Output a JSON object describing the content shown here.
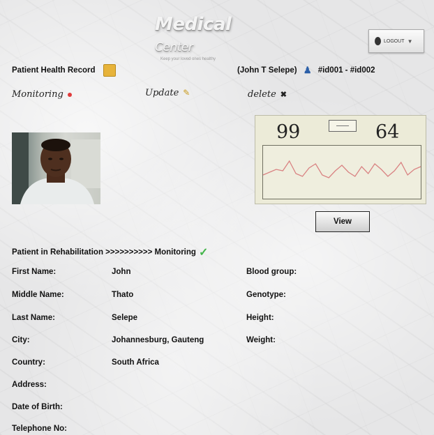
{
  "header": {
    "brand_main": "Medical",
    "brand_sub": "Center",
    "tagline": "Keep your loved ones healthy",
    "logout_label": "LOGOUT"
  },
  "record": {
    "title": "Patient Health Record",
    "patient_tag": "(John T Selepe)",
    "ids": "#id001 - #id002"
  },
  "actions": {
    "monitoring": "Monitoring",
    "update": "Update",
    "delete": "delete"
  },
  "monitor": {
    "left_value": "99",
    "right_value": "64",
    "trace": [
      14,
      18,
      22,
      20,
      34,
      16,
      12,
      24,
      30,
      14,
      10,
      20,
      28,
      18,
      12,
      26,
      16,
      30,
      22,
      12,
      20,
      32,
      14,
      22,
      26
    ]
  },
  "view_button": "View",
  "status_line": "Patient in Rehabilitation >>>>>>>>>> Monitoring",
  "fields_left": [
    {
      "label": "First Name:",
      "value": "John"
    },
    {
      "label": "Middle  Name:",
      "value": "Thato"
    },
    {
      "label": "Last Name:",
      "value": "Selepe"
    },
    {
      "label": "City:",
      "value": "Johannesburg,  Gauteng"
    },
    {
      "label": "Country:",
      "value": "South Africa"
    },
    {
      "label": "Address:",
      "value": ""
    },
    {
      "label": "Date of Birth:",
      "value": ""
    },
    {
      "label": "Telephone  No:",
      "value": ""
    }
  ],
  "fields_right": [
    {
      "label": "Blood group:"
    },
    {
      "label": "Genotype:"
    },
    {
      "label": "Height:"
    },
    {
      "label": "Weight:"
    }
  ]
}
